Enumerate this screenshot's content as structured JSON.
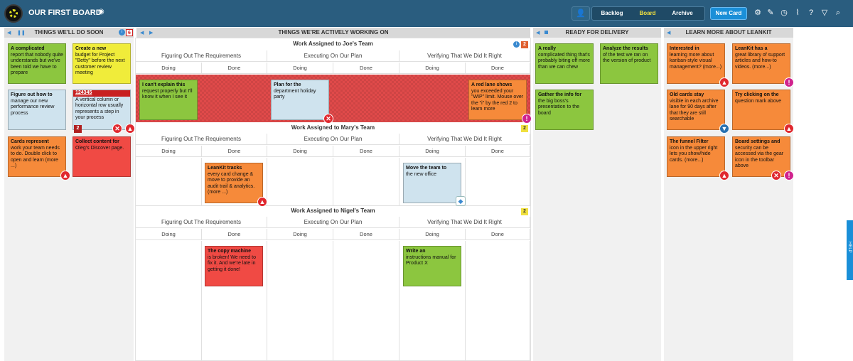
{
  "board": {
    "title": "OUR FIRST BOARD"
  },
  "toolbar": {
    "backlog": "Backlog",
    "board": "Board",
    "archive": "Archive",
    "new_card": "New Card",
    "icons": [
      "add-user-icon",
      "gear-icon",
      "edit-icon",
      "history-icon",
      "chart-icon",
      "help-icon",
      "filter-icon",
      "search-icon"
    ]
  },
  "lanes": {
    "soon": {
      "title": "THINGS WE'LL DO SOON",
      "info": "i",
      "wip": "6"
    },
    "working": {
      "title": "THINGS WE'RE ACTIVELY WORKING ON"
    },
    "ready": {
      "title": "READY FOR DELIVERY"
    },
    "learn": {
      "title": "LEARN MORE ABOUT LEANKIT"
    }
  },
  "swimlanes": {
    "joe": {
      "title": "Work Assigned to Joe's Team",
      "info": "i",
      "wip": "2"
    },
    "mary": {
      "title": "Work Assigned to Mary's Team",
      "wip": "2"
    },
    "nigel": {
      "title": "Work Assigned to Nigel's Team",
      "wip": "2"
    }
  },
  "columns": {
    "req": "Figuring Out The Requirements",
    "exec": "Executing On Our Plan",
    "verify": "Verifying That We Did It Right",
    "doing": "Doing",
    "done": "Done"
  },
  "cards": {
    "s1": {
      "title": "A complicated",
      "body": "report that nobody quite understands but we've been told we have to prepare"
    },
    "s2": {
      "title": "Create a new",
      "body": "budget for Project \"Betty\" before the next customer review meeting"
    },
    "s3": {
      "title": "Figure out how to",
      "body": "manage our new performance review process"
    },
    "s4": {
      "id": "124345",
      "body": "A vertical column or horizontal row usually represents a step in your process",
      "num": "2"
    },
    "s5": {
      "title": "Cards represent",
      "body": "work your team needs to do. Double click to open and learn (more ...)"
    },
    "s6": {
      "title": "Collect content for",
      "body": "Oleg's Discover page."
    },
    "j1": {
      "title": "I can't explain this",
      "body": "request properly but I'll know it when I see it"
    },
    "j2": {
      "title": "Plan for the",
      "body": "department holiday party"
    },
    "j3": {
      "title": "A red lane shows",
      "body": "you exceeded your \"WIP\" limit. Mouse over the \"i\" by the red 2 to learn more"
    },
    "m1": {
      "title": "LeanKit tracks",
      "body": "every card change & move to provide an audit trail & analytics. (more ...)"
    },
    "m2": {
      "title": "Move the team to",
      "body": "the new office"
    },
    "n1": {
      "title": "The copy machine",
      "body": "is broken! We need to fix it. And we're late in getting it done!"
    },
    "n2": {
      "title": "Write an",
      "body": "instructions manual for Product X"
    },
    "r1": {
      "title": "A really",
      "body": "complicated thing that's probably biting off more than we can chew"
    },
    "r2": {
      "title": "Analyze the results",
      "body": "of the test we ran on the version of product"
    },
    "r3": {
      "title": "Gather the info for",
      "body": "the big boss's presentation to the board"
    },
    "l1": {
      "title": "Interested in",
      "body": "learning more about kanban-style visual management? (more...)"
    },
    "l2": {
      "title": "LeanKit has a",
      "body": "great library of support articles and how-to videos. (more...)"
    },
    "l3": {
      "title": "Old cards stay",
      "body": "visible in each archive lane for 90 days after that they are still searchable"
    },
    "l4": {
      "title": "Try clicking on the",
      "body": "question mark above"
    },
    "l5": {
      "title": "The funnel Filter",
      "body": "icon in the upper right lets you show/hide cards. (more...)"
    },
    "l6": {
      "title": "Board settings and",
      "body": "security can be accessed via the gear icon in the toolbar above"
    }
  },
  "help": {
    "label": "HELP"
  }
}
